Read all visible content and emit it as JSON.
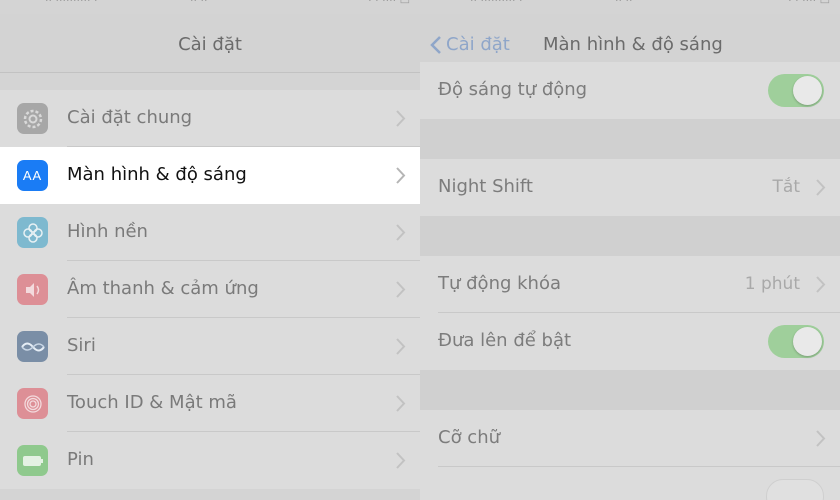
{
  "left": {
    "nav_title": "Cài đặt",
    "items": [
      {
        "label": "Cài đặt chung",
        "icon": "gear-icon",
        "color": "#a7a7a7"
      },
      {
        "label": "Màn hình & độ sáng",
        "icon": "display-brightness-icon",
        "color": "#1a7cf5",
        "selected": true,
        "icon_text": "AA"
      },
      {
        "label": "Hình nền",
        "icon": "wallpaper-flower-icon",
        "color": "#7eb9cf"
      },
      {
        "label": "Âm thanh & cảm ứng",
        "icon": "speaker-icon",
        "color": "#dd8f96"
      },
      {
        "label": "Siri",
        "icon": "siri-icon",
        "color": "#7a8ea6"
      },
      {
        "label": "Touch ID & Mật mã",
        "icon": "fingerprint-icon",
        "color": "#dd8f96"
      },
      {
        "label": "Pin",
        "icon": "battery-icon",
        "color": "#8fc98d"
      }
    ]
  },
  "right": {
    "back_label": "Cài đặt",
    "nav_title": "Màn hình & độ sáng",
    "auto_brightness": {
      "label": "Độ sáng tự động",
      "on": true
    },
    "night_shift": {
      "label": "Night Shift",
      "value": "Tắt"
    },
    "auto_lock": {
      "label": "Tự động khóa",
      "value": "1 phút"
    },
    "raise_to_wake": {
      "label": "Đưa lên để bật",
      "on": true
    },
    "text_size": {
      "label": "Cỡ chữ"
    }
  },
  "colors": {
    "toggle_on": "#9fcf9b",
    "back_blue": "#8fa6c9",
    "selected_row": "#ffffff"
  }
}
